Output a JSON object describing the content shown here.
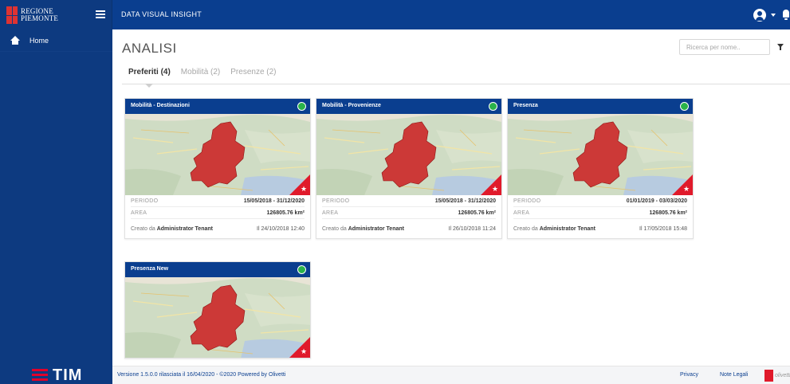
{
  "brand": {
    "logo_line1": "REGIONE",
    "logo_line2": "PIEMONTE"
  },
  "header": {
    "app_title": "DATA VISUAL INSIGHT"
  },
  "sidebar": {
    "items": [
      {
        "label": "Home",
        "icon": "home-icon"
      }
    ],
    "footer_logo": "TIM"
  },
  "main": {
    "title": "ANALISI",
    "search": {
      "placeholder": "Ricerca per nome..",
      "value": ""
    },
    "tabs": [
      {
        "label": "Preferiti (4)",
        "active": true
      },
      {
        "label": "Mobilità (2)",
        "active": false
      },
      {
        "label": "Presenze (2)",
        "active": false
      }
    ],
    "cards": [
      {
        "title": "Mobilità - Destinazioni",
        "status_color": "#2ab34a",
        "favorite": true,
        "period_label": "PERIODO",
        "period_value": "15/05/2018 - 31/12/2020",
        "area_label": "AREA",
        "area_value": "126805.76 km²",
        "created_by_prefix": "Creato da",
        "created_by": "Administrator Tenant",
        "created_at": "Il 24/10/2018 12:40"
      },
      {
        "title": "Mobilità - Provenienze",
        "status_color": "#2ab34a",
        "favorite": true,
        "period_label": "PERIODO",
        "period_value": "15/05/2018 - 31/12/2020",
        "area_label": "AREA",
        "area_value": "126805.76 km²",
        "created_by_prefix": "Creato da",
        "created_by": "Administrator Tenant",
        "created_at": "Il 26/10/2018 11:24"
      },
      {
        "title": "Presenza",
        "status_color": "#2ab34a",
        "favorite": true,
        "period_label": "PERIODO",
        "period_value": "01/01/2019 - 03/03/2020",
        "area_label": "AREA",
        "area_value": "126805.76 km²",
        "created_by_prefix": "Creato da",
        "created_by": "Administrator Tenant",
        "created_at": "Il 17/05/2018 15:48"
      },
      {
        "title": "Presenza New",
        "status_color": "#2ab34a",
        "favorite": true
      }
    ]
  },
  "footer": {
    "version_text": "Versione 1.5.0.0 rilasciata il 16/04/2020 - ©2020 Powered by Olivetti",
    "privacy": "Privacy",
    "legal": "Note Legali",
    "badge": "olivetti"
  },
  "colors": {
    "primary": "#0a3e8f",
    "sidebar": "#0d3a80",
    "accent_red": "#e01a2b",
    "status_green": "#2ab34a",
    "map_region": "#cc2a2a"
  }
}
